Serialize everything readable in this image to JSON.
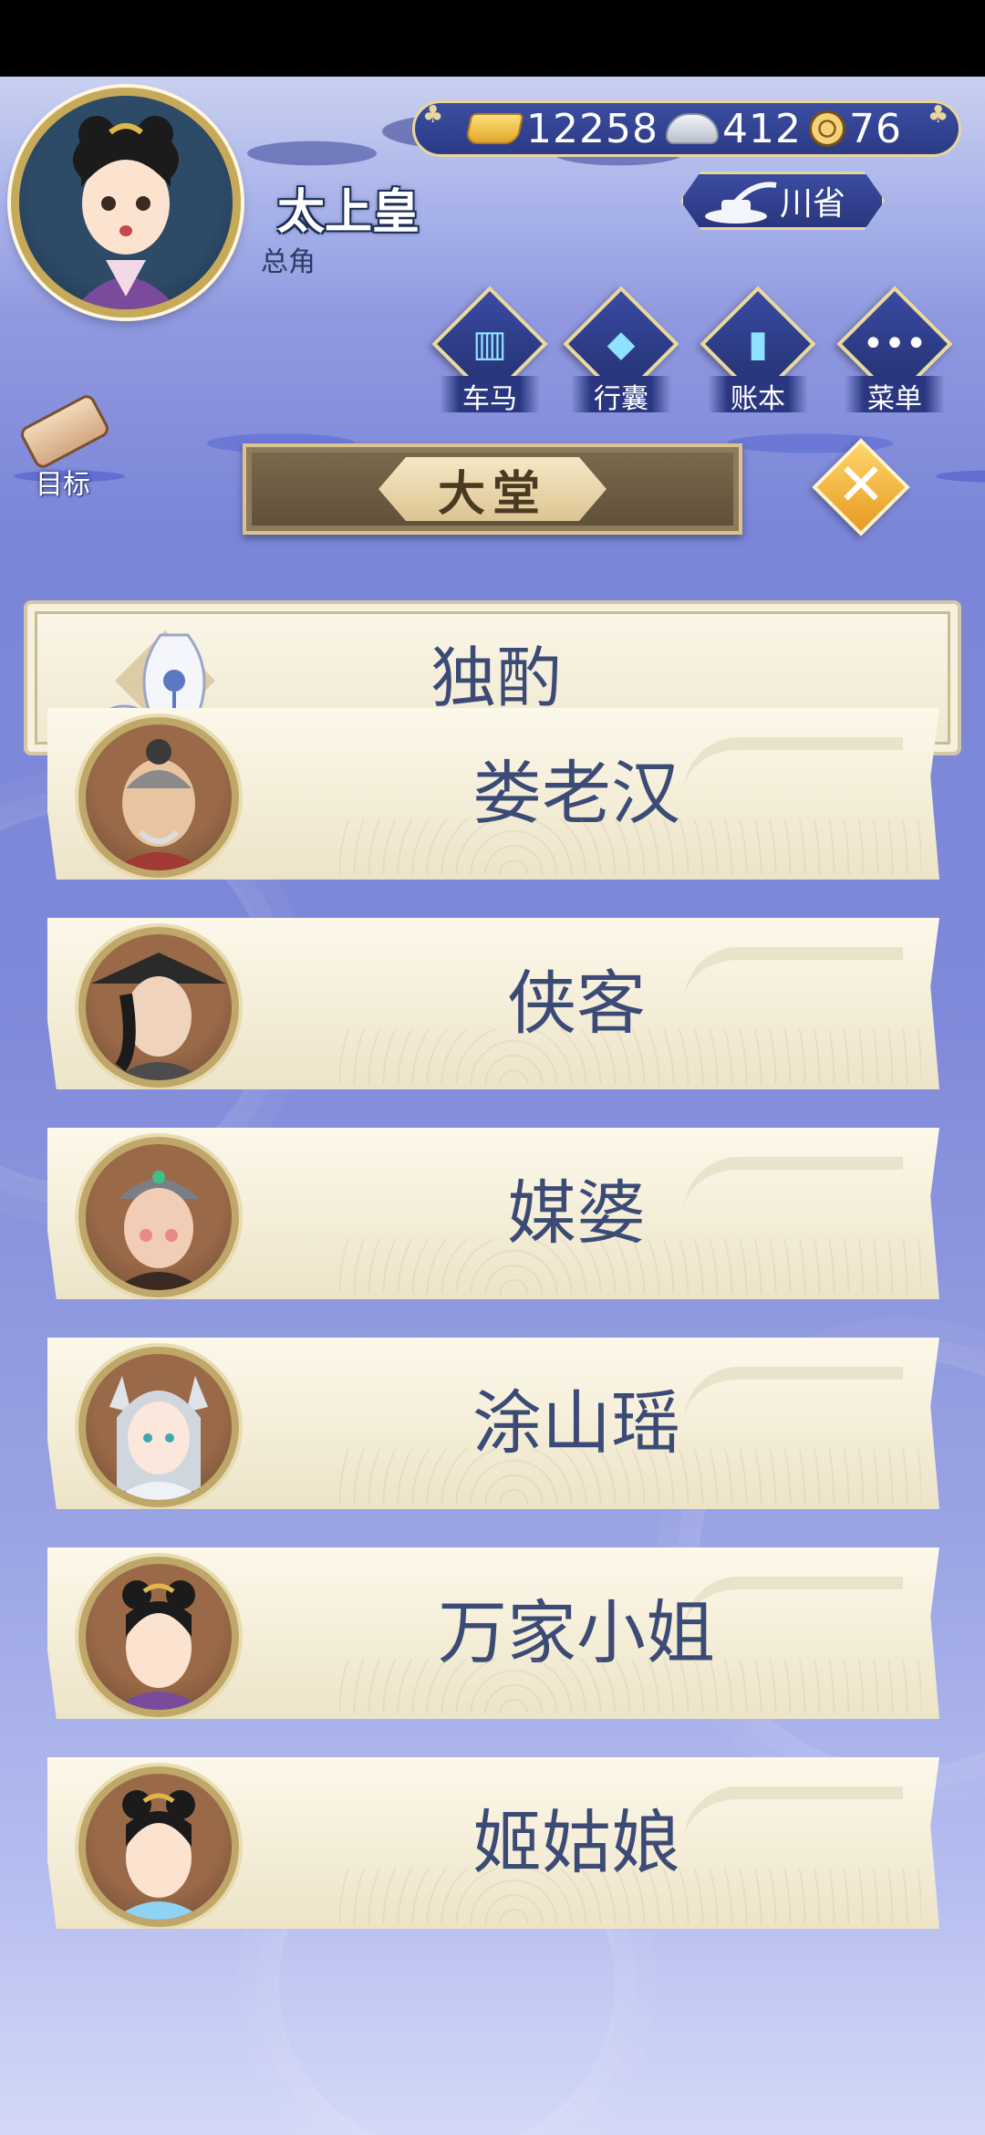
{
  "player": {
    "name": "太上皇",
    "role": "总角"
  },
  "currency": {
    "gold": "12258",
    "silver": "412",
    "coins": "76"
  },
  "location": {
    "label": "川省"
  },
  "nav": [
    {
      "label": "车马",
      "icon": "carriage-icon"
    },
    {
      "label": "行囊",
      "icon": "bag-icon"
    },
    {
      "label": "账本",
      "icon": "ledger-icon"
    },
    {
      "label": "菜单",
      "icon": "menu-icon"
    }
  ],
  "goal": {
    "label": "目标"
  },
  "title": {
    "text": "大堂"
  },
  "drink": {
    "label": "独酌"
  },
  "npcs": [
    {
      "name": "娄老汉"
    },
    {
      "name": "侠客"
    },
    {
      "name": "媒婆"
    },
    {
      "name": "涂山瑶"
    },
    {
      "name": "万家小姐"
    },
    {
      "name": "姬姑娘"
    }
  ],
  "colors": {
    "accent": "#e9d99b",
    "panel": "#fbf6e8",
    "text": "#3c4b76",
    "bg": "#7b86d8"
  }
}
